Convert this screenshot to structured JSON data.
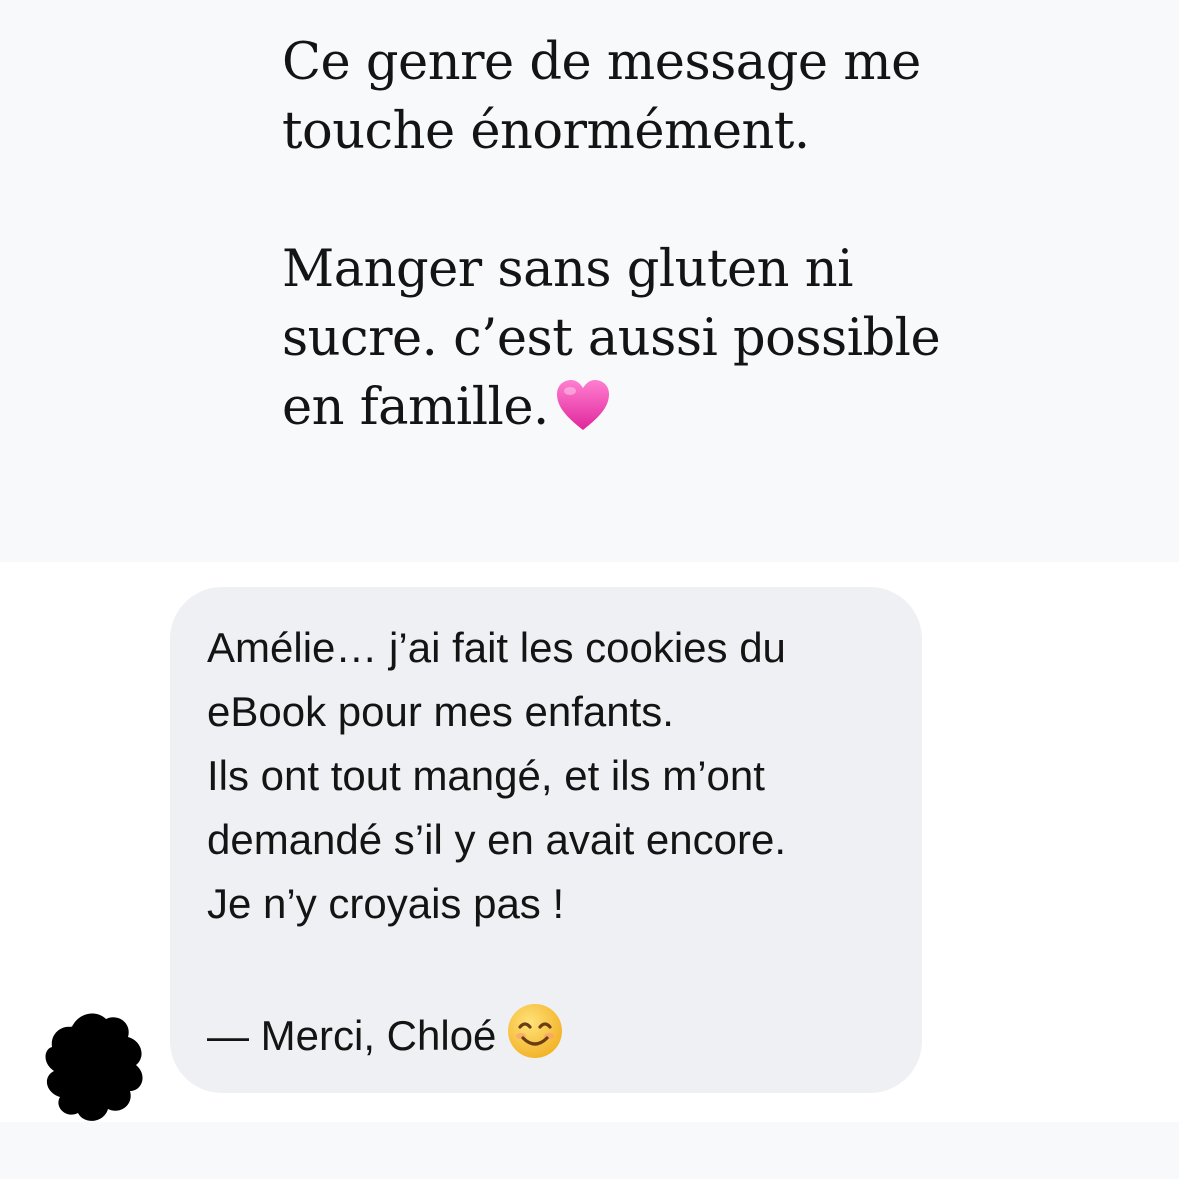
{
  "post": {
    "line1": "Ce genre de message me",
    "line2": "touche énormément.",
    "line3": "Manger sans gluten ni",
    "line4": "sucre. c’est aussi possible",
    "line5": "en famille.",
    "heart_icon": "pink-heart-emoji"
  },
  "message": {
    "line1": "Amélie… j’ai fait les cookies du",
    "line2": "eBook pour mes enfants.",
    "line3": "Ils ont tout mangé, et ils m’ont",
    "line4": "demandé s’il y en avait encore.",
    "line5": "Je n’y croyais pas !",
    "signature": "— Merci, Chloé",
    "smile_icon": "smiling-face-emoji"
  },
  "colors": {
    "top_background": "#f8f9fb",
    "bubble_background": "#eff0f3",
    "text": "#141414",
    "heart": "#f04fb4",
    "smile": "#f7c23a"
  }
}
